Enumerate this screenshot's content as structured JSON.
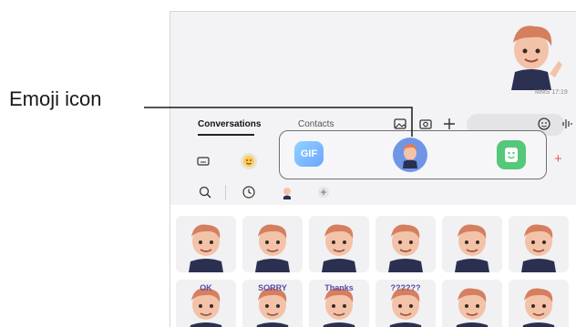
{
  "callout": {
    "label": "Emoji icon"
  },
  "chat": {
    "message_meta": "MMS 17:19"
  },
  "tabs": [
    {
      "label": "Conversations",
      "active": true
    },
    {
      "label": "Contacts",
      "active": false
    }
  ],
  "popup": {
    "gif_label": "GIF"
  },
  "colors": {
    "accent_red": "#f0545a",
    "avatar_blue": "#6f95e5",
    "bitmoji_green": "#55c879",
    "gif_blue": "#7fbcff"
  },
  "stickers": [
    {
      "name": "avatar-smile"
    },
    {
      "name": "avatar-cry"
    },
    {
      "name": "avatar-neutral"
    },
    {
      "name": "avatar-angry-puff"
    },
    {
      "name": "avatar-shocked"
    },
    {
      "name": "avatar-wave"
    },
    {
      "name": "avatar-ok"
    },
    {
      "name": "avatar-sorry"
    },
    {
      "name": "avatar-thanks"
    },
    {
      "name": "avatar-confused"
    },
    {
      "name": "avatar-dizzy"
    },
    {
      "name": "avatar-rain"
    }
  ],
  "sticker_caption_text": [
    "OK",
    "SORRY",
    "Thanks",
    "??????"
  ]
}
